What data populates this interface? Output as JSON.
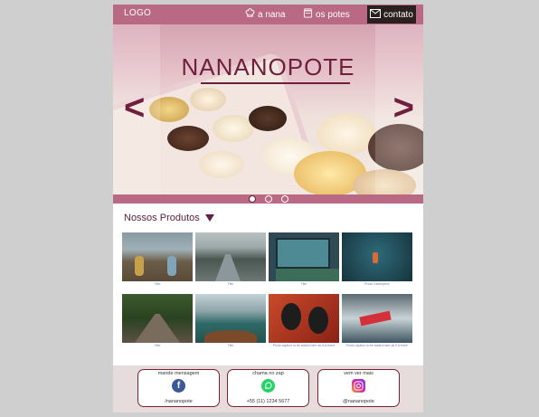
{
  "header": {
    "logo": "LOGO",
    "nav": [
      {
        "label": "a nana",
        "icon": "chef-hat-icon"
      },
      {
        "label": "os potes",
        "icon": "jar-icon"
      }
    ],
    "contact_label": "contato",
    "contact_icon": "mail-icon"
  },
  "hero": {
    "title": "NANANOPOTE",
    "prev_symbol": "<",
    "next_symbol": ">",
    "slides": 3,
    "active_slide": 1
  },
  "products": {
    "title": "Nossos Produtos",
    "items": [
      {
        "scene": "couple-field",
        "caption": "Title"
      },
      {
        "scene": "river-boats",
        "caption": "Title"
      },
      {
        "scene": "window-green",
        "caption": "Title"
      },
      {
        "scene": "boat-sea",
        "caption": "Photo Description"
      },
      {
        "scene": "bridge-forest",
        "caption": "Title"
      },
      {
        "scene": "lake-boat",
        "caption": "Title"
      },
      {
        "scene": "headphones",
        "caption": "Photo caption to be added here as it is there"
      },
      {
        "scene": "surfer",
        "caption": "Photo caption to be added here as it is there"
      }
    ]
  },
  "footer": {
    "cards": [
      {
        "label": "mande mensagem",
        "icon": "facebook-icon",
        "value": "/nananopote",
        "color": "#3b5998"
      },
      {
        "label": "chama no zap",
        "icon": "whatsapp-icon",
        "value": "+55 (11) 1234 5677",
        "color": "#25d366"
      },
      {
        "label": "vem ver mais",
        "icon": "instagram-icon",
        "value": "@nananopote",
        "color": "#d6249f"
      }
    ]
  },
  "colors": {
    "accent": "#b96984",
    "brand": "#6e1f3e",
    "dark": "#2b2020"
  }
}
